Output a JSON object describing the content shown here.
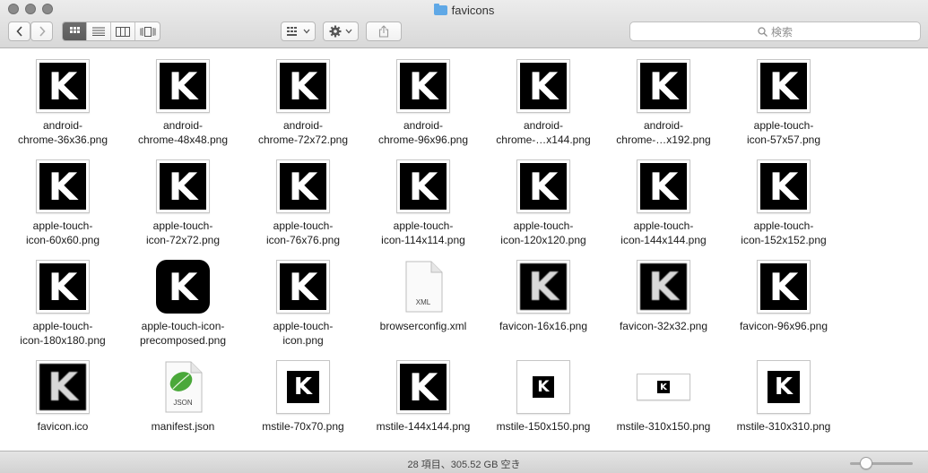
{
  "window": {
    "title": "favicons"
  },
  "toolbar": {
    "search_placeholder": "検索",
    "view_modes": [
      "icon-view",
      "list-view",
      "column-view",
      "cover-flow-view"
    ],
    "active_view": 0
  },
  "files": [
    {
      "name": "android-\nchrome-36x36.png",
      "kind": "k"
    },
    {
      "name": "android-\nchrome-48x48.png",
      "kind": "k"
    },
    {
      "name": "android-\nchrome-72x72.png",
      "kind": "k"
    },
    {
      "name": "android-\nchrome-96x96.png",
      "kind": "k"
    },
    {
      "name": "android-\nchrome-…x144.png",
      "kind": "k"
    },
    {
      "name": "android-\nchrome-…x192.png",
      "kind": "k"
    },
    {
      "name": "apple-touch-\nicon-57x57.png",
      "kind": "k"
    },
    {
      "name": "apple-touch-\nicon-60x60.png",
      "kind": "k"
    },
    {
      "name": "apple-touch-\nicon-72x72.png",
      "kind": "k"
    },
    {
      "name": "apple-touch-\nicon-76x76.png",
      "kind": "k"
    },
    {
      "name": "apple-touch-\nicon-114x114.png",
      "kind": "k"
    },
    {
      "name": "apple-touch-\nicon-120x120.png",
      "kind": "k"
    },
    {
      "name": "apple-touch-\nicon-144x144.png",
      "kind": "k"
    },
    {
      "name": "apple-touch-\nicon-152x152.png",
      "kind": "k"
    },
    {
      "name": "apple-touch-\nicon-180x180.png",
      "kind": "k"
    },
    {
      "name": "apple-touch-icon-\nprecomposed.png",
      "kind": "round"
    },
    {
      "name": "apple-touch-\nicon.png",
      "kind": "k"
    },
    {
      "name": "browserconfig.xml",
      "kind": "xml",
      "doc_label": "XML"
    },
    {
      "name": "favicon-16x16.png",
      "kind": "blur"
    },
    {
      "name": "favicon-32x32.png",
      "kind": "blur"
    },
    {
      "name": "favicon-96x96.png",
      "kind": "k"
    },
    {
      "name": "favicon.ico",
      "kind": "blur"
    },
    {
      "name": "manifest.json",
      "kind": "json",
      "doc_label": "JSON"
    },
    {
      "name": "mstile-70x70.png",
      "kind": "tile"
    },
    {
      "name": "mstile-144x144.png",
      "kind": "k"
    },
    {
      "name": "mstile-150x150.png",
      "kind": "tile-small"
    },
    {
      "name": "mstile-310x150.png",
      "kind": "wide"
    },
    {
      "name": "mstile-310x310.png",
      "kind": "tile"
    }
  ],
  "status": {
    "text": "28 項目、305.52 GB 空き",
    "icon_size_fraction": 0.25
  },
  "colors": {
    "accent": "#5fa8e6",
    "json_leaf": "#4aa83a"
  }
}
